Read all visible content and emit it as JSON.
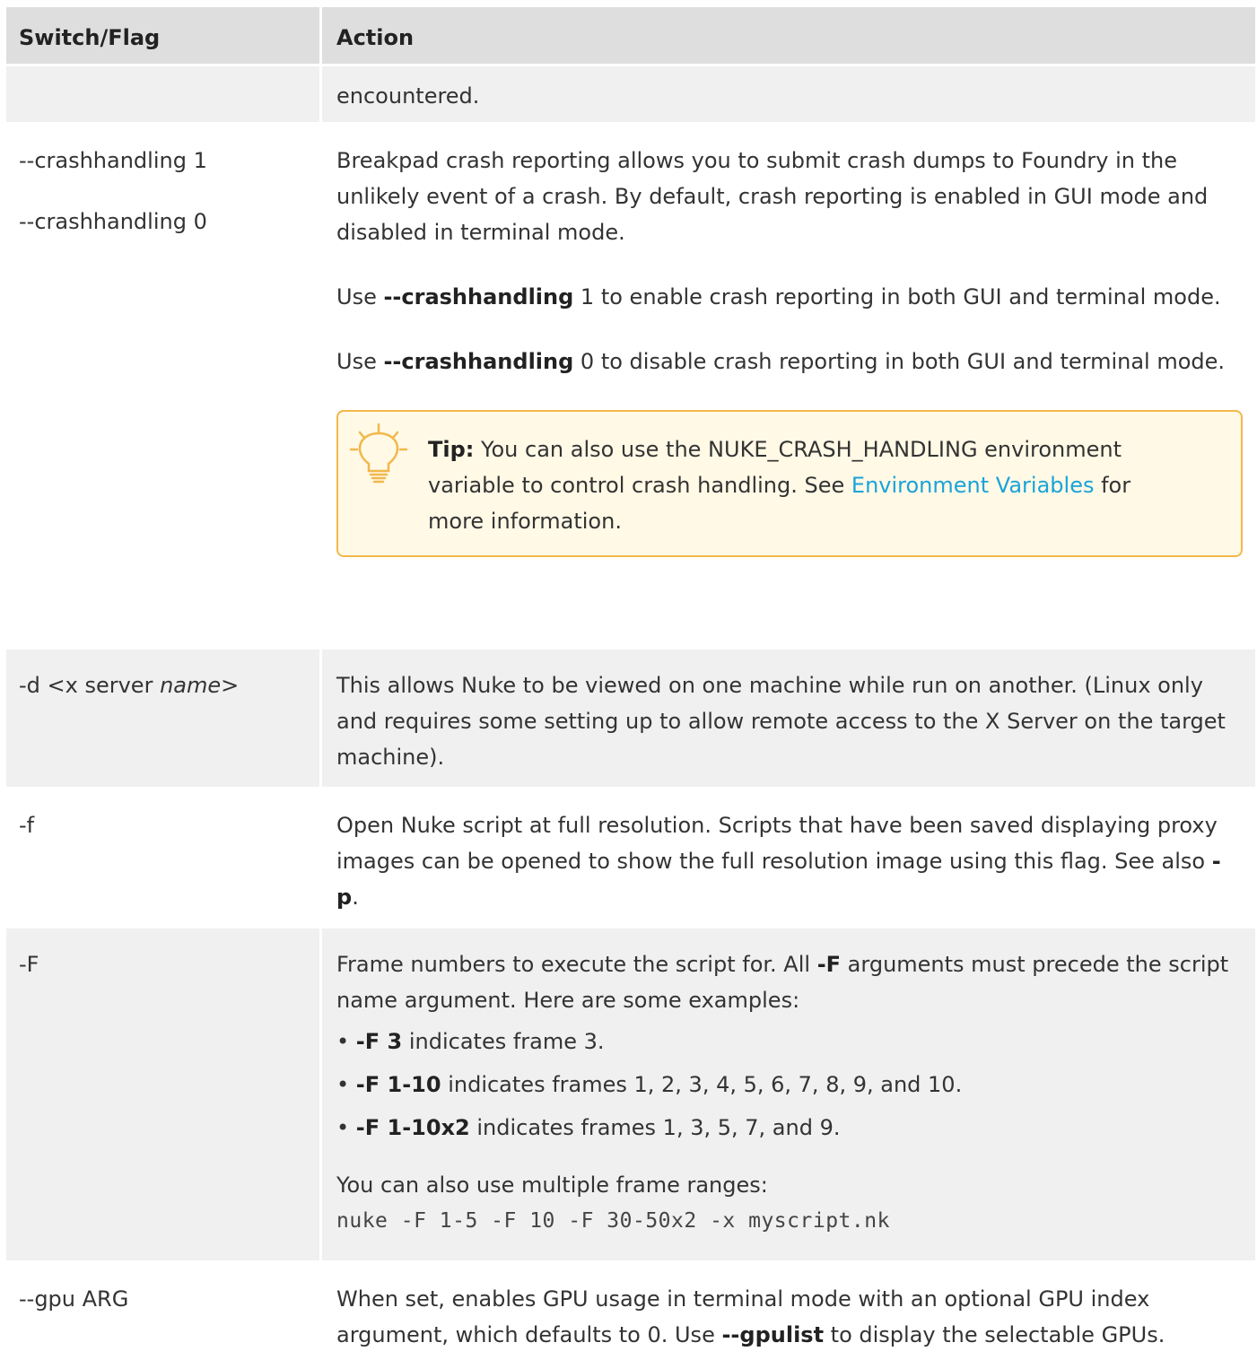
{
  "table": {
    "headers": {
      "switch": "Switch/Flag",
      "action": "Action"
    },
    "row0": {
      "action": "encountered."
    },
    "row1": {
      "switch1": "--crashhandling 1",
      "switch2": "--crashhandling 0",
      "p1": "Breakpad crash reporting allows you to submit crash dumps to Foundry in the unlikely event of a crash. By default, crash reporting is enabled in GUI mode and disabled in terminal mode.",
      "p2_pre": "Use ",
      "p2_bold": "--crashhandling",
      "p2_post": " 1 to enable crash reporting in both GUI and terminal mode.",
      "p3_pre": "Use ",
      "p3_bold": "--crashhandling",
      "p3_post": " 0 to disable crash reporting in both GUI and terminal mode.",
      "tip": {
        "label": "Tip:",
        "text_pre": "  You can also use the NUKE_CRASH_HANDLING environment variable to control crash handling. See ",
        "link": "Environment Variables",
        "text_post": " for more information.",
        "icon": "lightbulb-icon"
      }
    },
    "row2": {
      "switch_pre": "-d <x server ",
      "switch_italic": "name",
      "switch_post": ">",
      "action": "This allows Nuke to be viewed on one machine while run on another. (Linux only and requires some setting up to allow remote access to the X Server on the target machine)."
    },
    "row3": {
      "switch": "-f",
      "action_pre": "Open Nuke script at full resolution. Scripts that have been saved displaying proxy images can be opened to show the full resolution image using this flag. See also ",
      "action_bold": "-p",
      "action_post": "."
    },
    "row4": {
      "switch": "-F",
      "p1_pre": "Frame numbers to execute the script for. All ",
      "p1_bold": "-F",
      "p1_post": " arguments must precede the script name argument. Here are some examples:",
      "bullets": [
        {
          "bold": "-F 3",
          "text": " indicates frame 3."
        },
        {
          "bold": "-F 1-10",
          "text": " indicates frames 1, 2, 3, 4, 5, 6, 7, 8, 9, and 10."
        },
        {
          "bold": "-F 1-10x2",
          "text": " indicates frames 1, 3, 5, 7, and 9."
        }
      ],
      "bullet_char": "•",
      "p2": "You can also use multiple frame ranges:",
      "code": "nuke -F 1-5 -F 10 -F 30-50x2 -x myscript.nk"
    },
    "row5": {
      "switch": "--gpu ARG",
      "action_pre": "When set, enables GPU usage in terminal mode with an optional GPU index argument, which defaults to 0. Use ",
      "action_bold": "--gpulist",
      "action_post": " to display the selectable GPUs."
    }
  },
  "colors": {
    "header_bg": "#dedede",
    "alt_bg": "#f0f0f0",
    "tip_border": "#f2b84b",
    "link": "#1aa3d9"
  }
}
